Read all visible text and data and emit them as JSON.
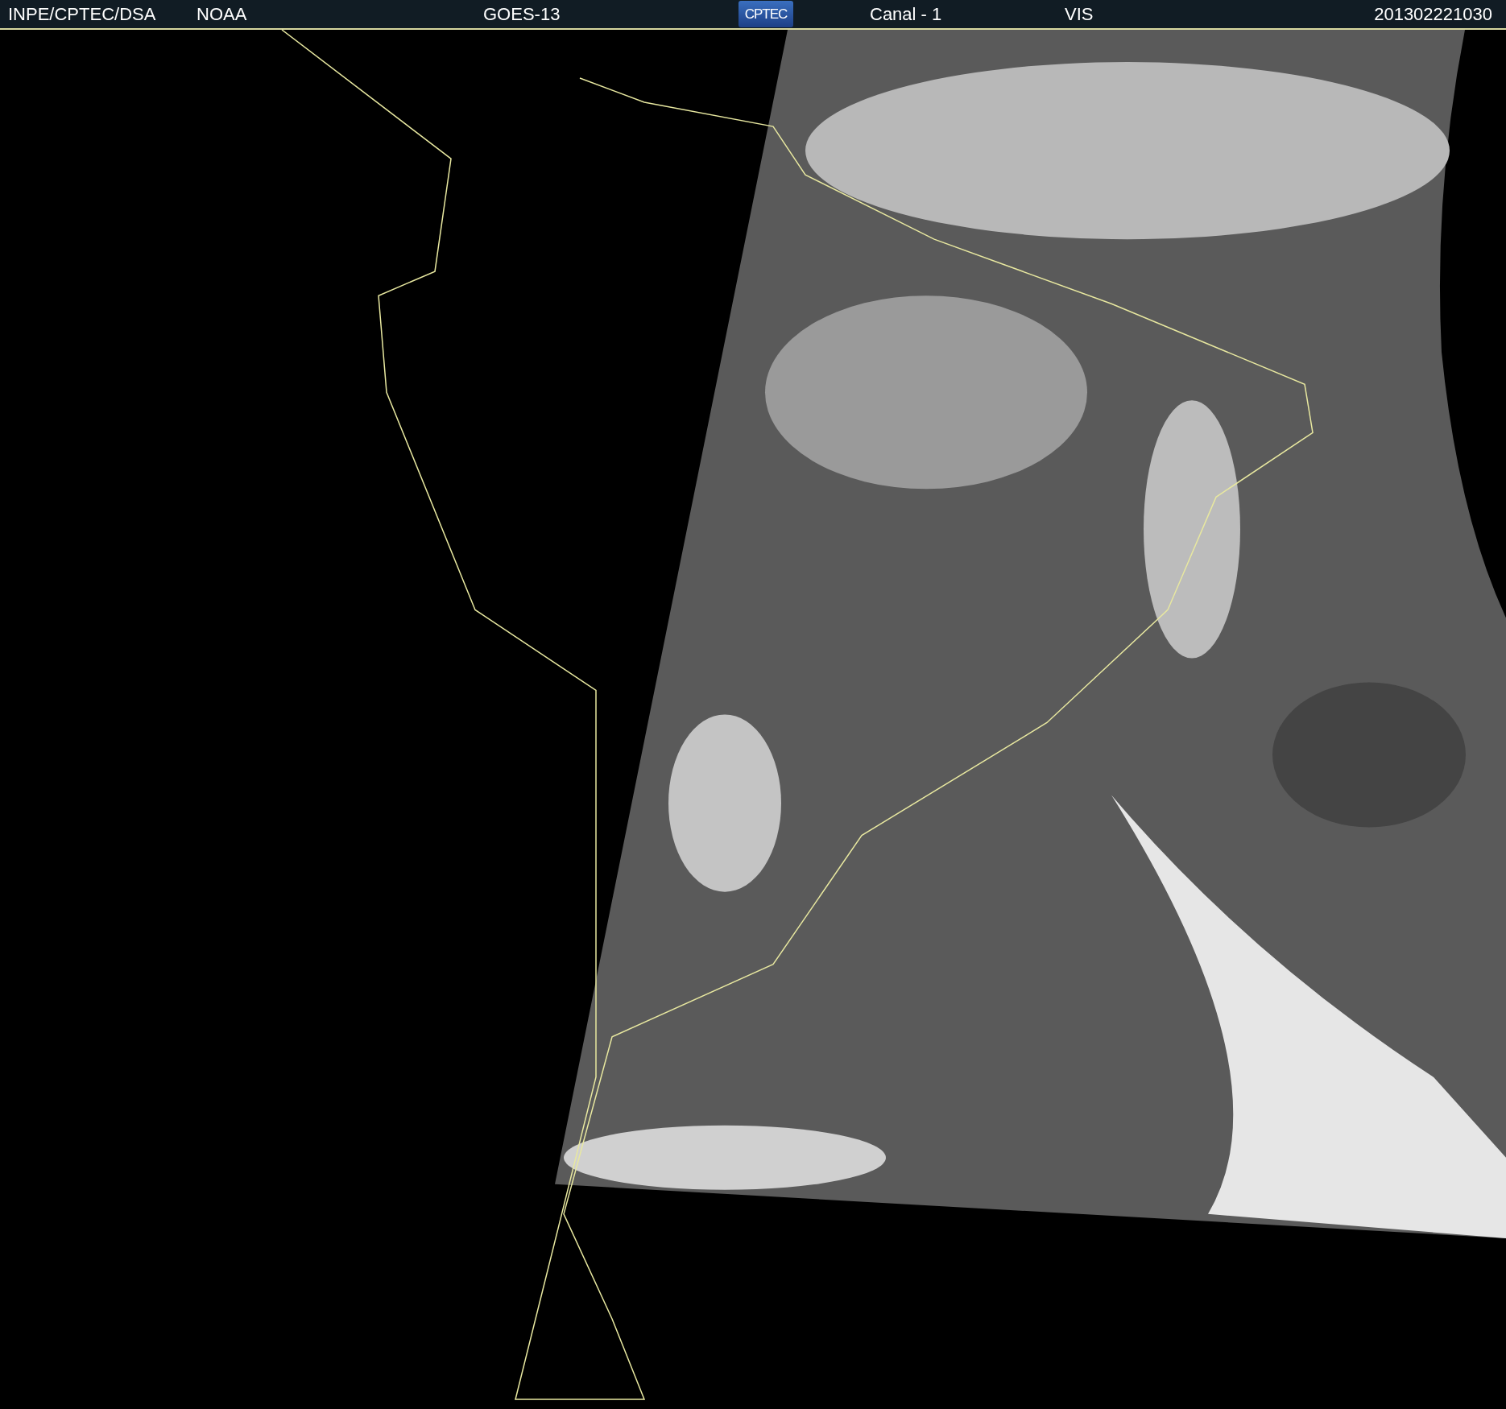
{
  "header": {
    "agency": "INPE/CPTEC/DSA",
    "source": "NOAA",
    "satellite": "GOES-13",
    "logo": "CPTEC",
    "channel": "Canal - 1",
    "band": "VIS",
    "timestamp": "201302221030"
  }
}
